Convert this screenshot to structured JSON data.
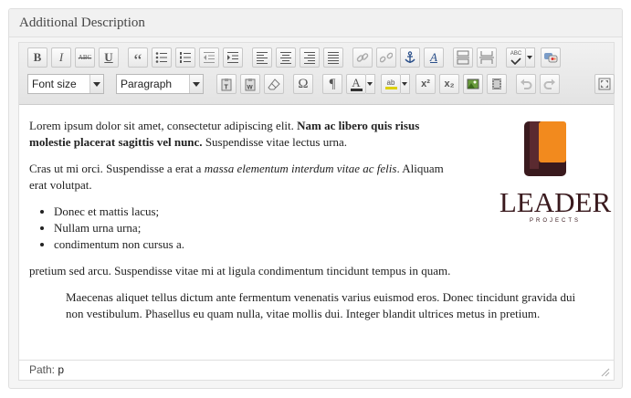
{
  "panel": {
    "title": "Additional Description"
  },
  "toolbar": {
    "row1": [
      {
        "name": "bold-button",
        "glyph": "B"
      },
      {
        "name": "italic-button",
        "glyph": "I"
      },
      {
        "name": "strikethrough-button",
        "glyph": "ABC"
      },
      {
        "name": "underline-button",
        "glyph": "U"
      },
      {
        "name": "blockquote-button",
        "glyph": "“"
      },
      {
        "name": "bullet-list-button",
        "glyph": ""
      },
      {
        "name": "numbered-list-button",
        "glyph": ""
      },
      {
        "name": "outdent-button",
        "glyph": ""
      },
      {
        "name": "indent-button",
        "glyph": ""
      },
      {
        "name": "align-left-button",
        "glyph": ""
      },
      {
        "name": "align-center-button",
        "glyph": ""
      },
      {
        "name": "align-right-button",
        "glyph": ""
      },
      {
        "name": "align-justify-button",
        "glyph": ""
      },
      {
        "name": "insert-link-button",
        "glyph": ""
      },
      {
        "name": "unlink-button",
        "glyph": ""
      },
      {
        "name": "anchor-button",
        "glyph": ""
      },
      {
        "name": "styles-button",
        "glyph": "A"
      },
      {
        "name": "insert-more-button",
        "glyph": ""
      },
      {
        "name": "page-break-button",
        "glyph": ""
      },
      {
        "name": "spellcheck-button",
        "glyph": "ABC"
      },
      {
        "name": "toggle-kitchen-sink-button",
        "glyph": ""
      }
    ],
    "font_size": {
      "value": "Font size"
    },
    "font_family": {
      "value": "Paragraph"
    },
    "row2": [
      {
        "name": "paste-text-button"
      },
      {
        "name": "paste-word-button"
      },
      {
        "name": "clear-formatting-button"
      },
      {
        "name": "special-character-button",
        "glyph": "Ω"
      },
      {
        "name": "paragraph-mark-button",
        "glyph": "¶"
      },
      {
        "name": "text-color-button",
        "glyph": "A"
      },
      {
        "name": "highlight-color-button",
        "glyph": "ab"
      },
      {
        "name": "superscript-button",
        "glyph": "x²"
      },
      {
        "name": "subscript-button",
        "glyph": "x₂"
      },
      {
        "name": "insert-image-button"
      },
      {
        "name": "insert-media-button"
      },
      {
        "name": "undo-button"
      },
      {
        "name": "redo-button"
      },
      {
        "name": "fullscreen-button"
      }
    ]
  },
  "content": {
    "p1_start": "Lorem ipsum dolor sit amet, consectetur adipiscing elit. ",
    "p1_bold": "Nam ac libero quis risus molestie placerat sagittis vel nunc.",
    "p1_end": " Suspendisse vitae lectus urna.",
    "p2_start": "Cras ut mi orci. Suspendisse a erat a ",
    "p2_italic": "massa elementum interdum vitae ac felis",
    "p2_end": ". Aliquam erat volutpat.",
    "list": [
      "Donec et mattis lacus;",
      "Nullam urna urna;",
      "condimentum non cursus a."
    ],
    "p3": "pretium sed arcu. Suspendisse vitae mi at ligula condimentum tincidunt tempus in quam.",
    "quote": "Maecenas aliquet tellus dictum ante fermentum venenatis varius euismod eros. Donec tincidunt gravida dui non vestibulum. Phasellus eu quam nulla, vitae mollis dui. Integer blandit ultrices metus in pretium."
  },
  "logo": {
    "name": "LEADER",
    "tagline": "PROJECTS",
    "colors": {
      "dark": "#3a1a1e",
      "orange": "#f28a1e"
    }
  },
  "status": {
    "path_label": "Path:",
    "path_value": "p"
  }
}
